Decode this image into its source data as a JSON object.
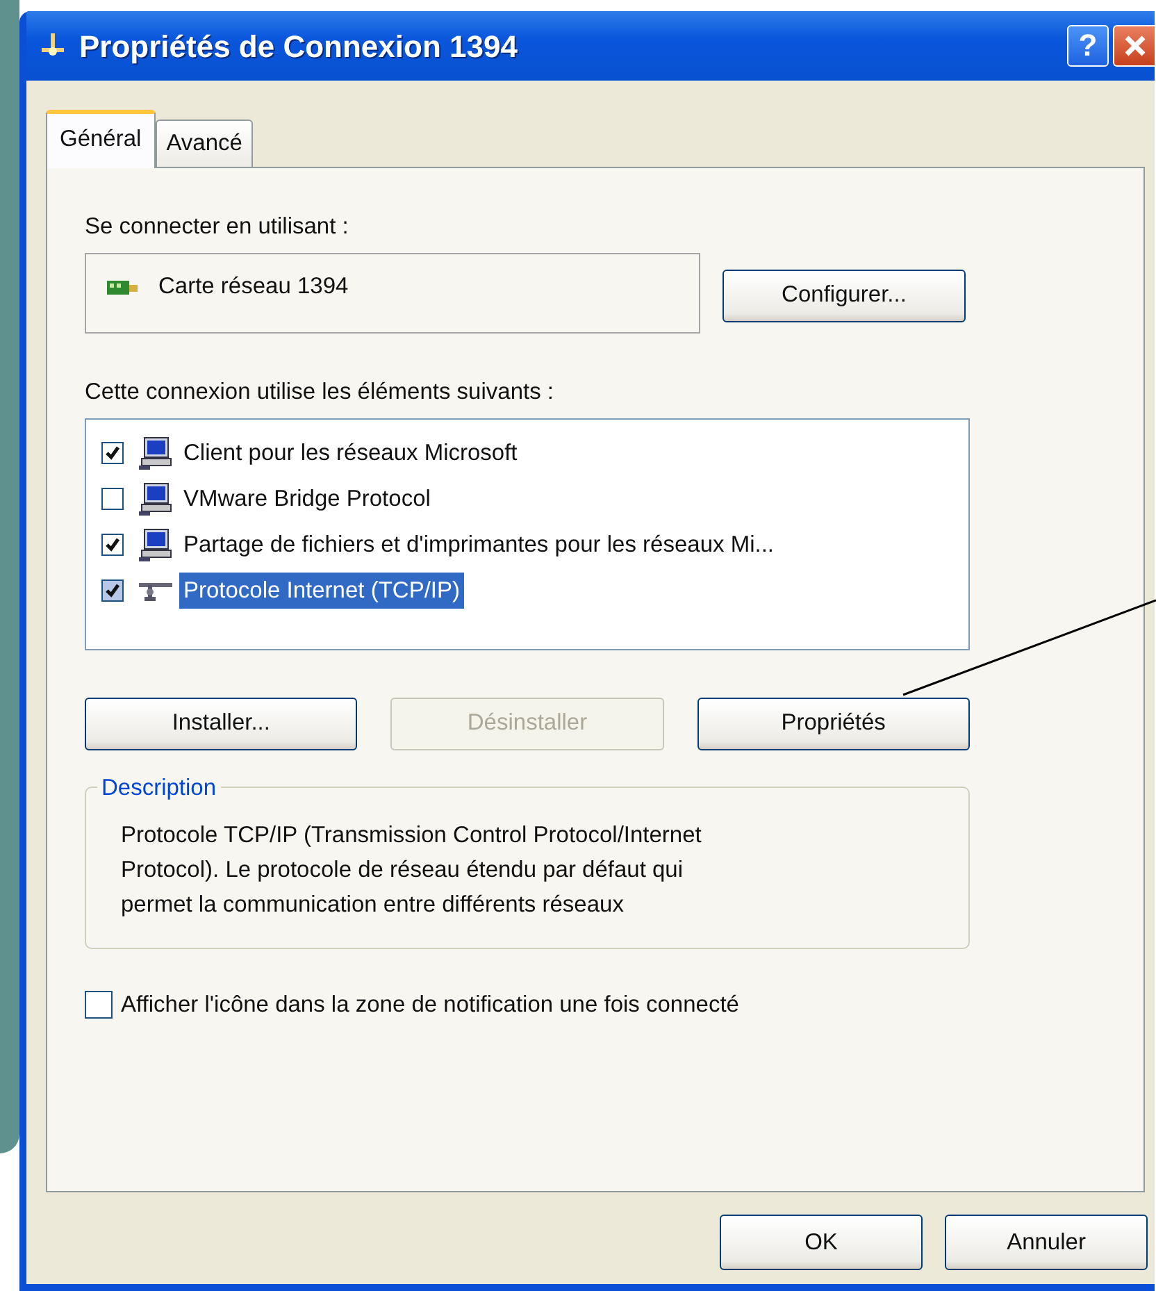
{
  "window": {
    "title": "Propriétés de Connexion 1394",
    "help": "?"
  },
  "tabs": [
    {
      "label": "Général",
      "selected": true
    },
    {
      "label": "Avancé",
      "selected": false
    }
  ],
  "connect_using": {
    "label": "Se connecter en utilisant :",
    "adapter": "Carte réseau 1394",
    "button": "Configurer..."
  },
  "components": {
    "label": "Cette connexion utilise les éléments suivants :",
    "items": [
      {
        "name": "Client pour les réseaux Microsoft",
        "checked": true,
        "selected": false,
        "kind": "computer"
      },
      {
        "name": "VMware Bridge Protocol",
        "checked": false,
        "selected": false,
        "kind": "computer"
      },
      {
        "name": "Partage de fichiers et d'imprimantes pour les réseaux Mi...",
        "checked": true,
        "selected": false,
        "kind": "computer"
      },
      {
        "name": "Protocole Internet (TCP/IP)",
        "checked": true,
        "selected": true,
        "kind": "protocol"
      }
    ]
  },
  "actions": [
    {
      "label": "Installer...",
      "disabled": false
    },
    {
      "label": "Désinstaller",
      "disabled": true
    },
    {
      "label": "Propriétés",
      "disabled": false
    }
  ],
  "description": {
    "legend": "Description",
    "lines": [
      "Protocole TCP/IP (Transmission Control Protocol/Internet",
      "Protocol). Le protocole de réseau étendu par défaut qui",
      "permet la communication entre différents réseaux"
    ]
  },
  "notify": {
    "label": "Afficher l'icône dans la zone de notification une fois connecté",
    "checked": false
  },
  "footer_buttons": [
    "OK",
    "Annuler"
  ]
}
